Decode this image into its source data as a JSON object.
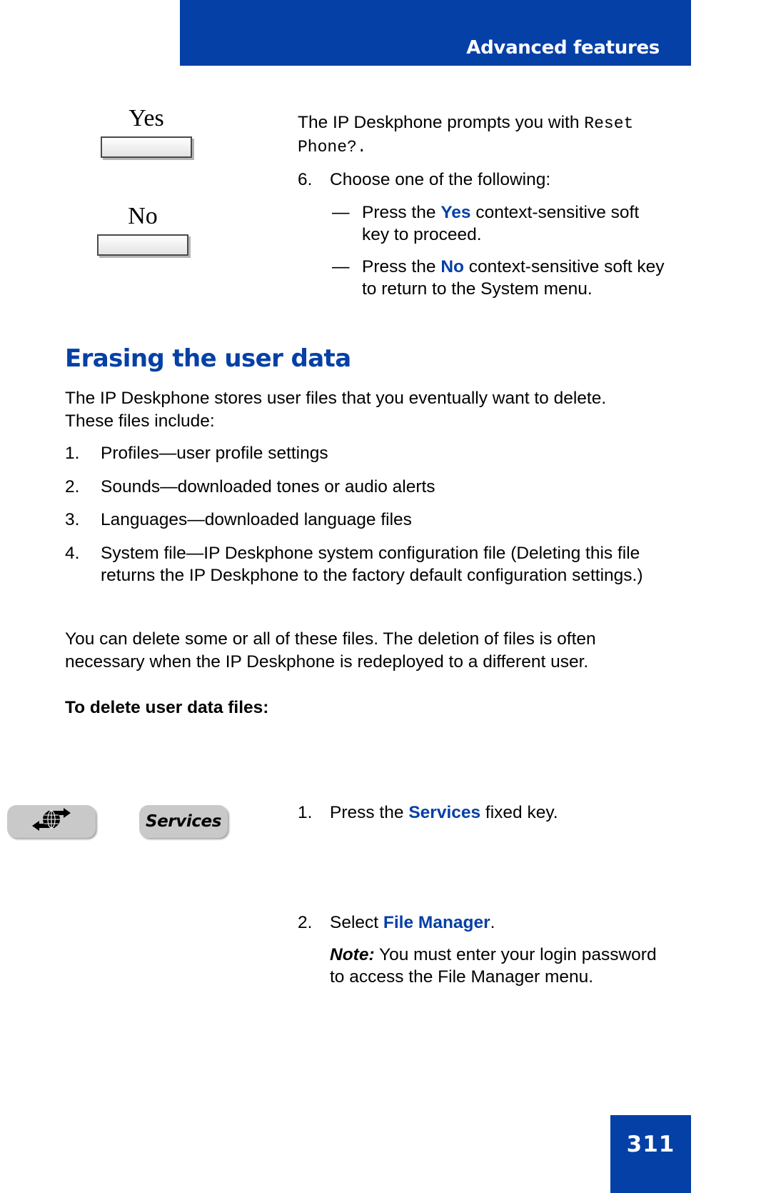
{
  "header": {
    "title": "Advanced features"
  },
  "softkeys": [
    {
      "label": "Yes",
      "name": "yes-softkey"
    },
    {
      "label": "No",
      "name": "no-softkey"
    }
  ],
  "top_section": {
    "prompt_lead": "The IP Deskphone prompts you with ",
    "prompt_mono_1": "Reset",
    "prompt_mono_2": "Phone?.",
    "step6_num": "6.",
    "step6_text": "Choose one of the following:",
    "dash": "—",
    "bullet1_pre": "Press the ",
    "bullet1_key": "Yes",
    "bullet1_post": " context-sensitive soft key to proceed.",
    "bullet2_pre": "Press the ",
    "bullet2_key": "No",
    "bullet2_post": " context-sensitive soft key to return to the System menu."
  },
  "section": {
    "heading": "Erasing the user data",
    "intro": "The IP Deskphone stores user files that you eventually want to delete. These files include:",
    "file_types": [
      {
        "num": "1.",
        "text": "Profiles—user profile settings"
      },
      {
        "num": "2.",
        "text": "Sounds—downloaded tones or audio alerts"
      },
      {
        "num": "3.",
        "text": "Languages—downloaded language files"
      },
      {
        "num": "4.",
        "text": "System file—IP Deskphone system configuration file (Deleting this file returns the IP Deskphone to the factory default configuration settings.)"
      }
    ],
    "closing_para": "You can delete some or all of these files. The deletion of files is often necessary when the IP Deskphone is redeployed to a different user.",
    "procedure_heading": "To delete user data files:"
  },
  "keys": {
    "globe_icon_name": "globe-arrows-icon",
    "services_label": "Services"
  },
  "procedure": {
    "step1_num": "1.",
    "step1_pre": "Press the ",
    "step1_key": "Services",
    "step1_post": " fixed key.",
    "step2_num": "2.",
    "step2_pre": "Select ",
    "step2_key": "File Manager",
    "step2_post": ".",
    "note_label": "Note:",
    "note_text": "You must enter your login password to access the File Manager menu."
  },
  "footer": {
    "page_number": "311"
  },
  "colors": {
    "brand_blue": "#0540A6",
    "key_gray": "#c9c9c9"
  }
}
